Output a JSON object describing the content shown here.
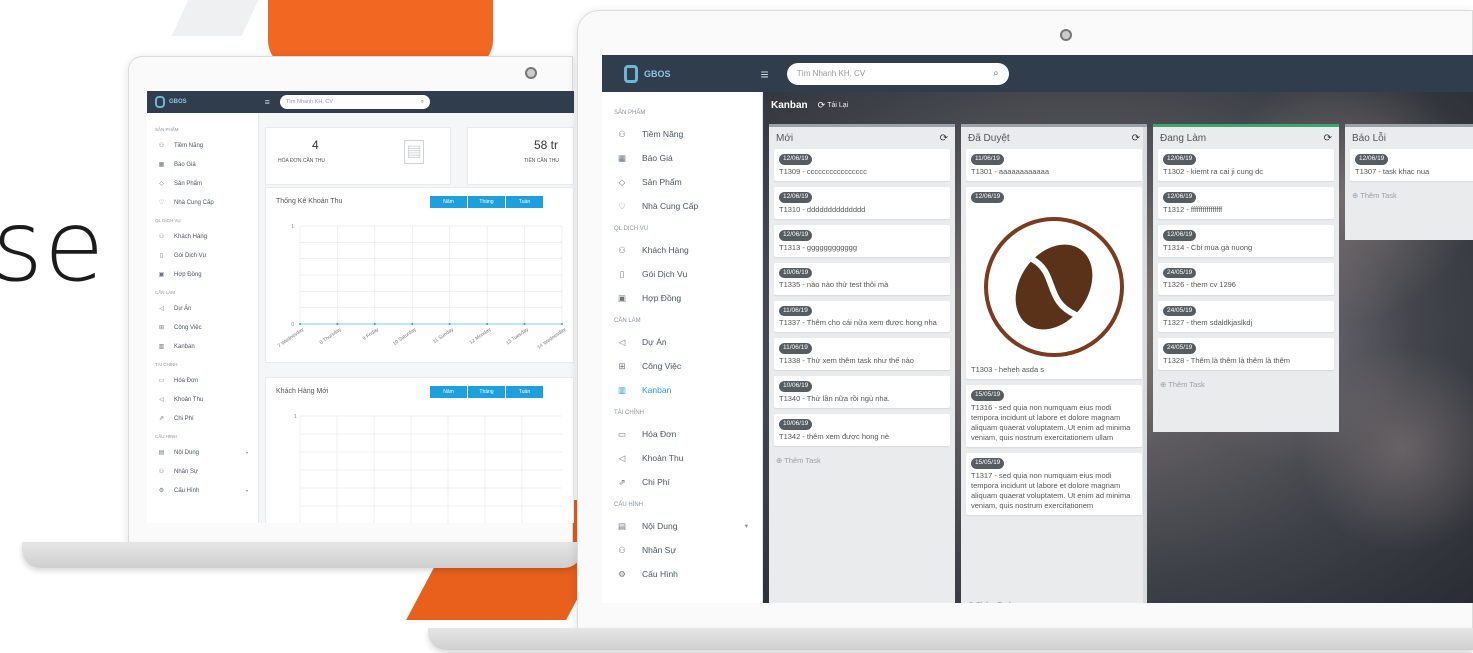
{
  "hero_text": "se",
  "small_laptop": {
    "logo": "GBOS",
    "search_placeholder": "Tìm Nhanh KH, CV",
    "sidebar": [
      {
        "type": "section",
        "label": "SẢN PHẨM"
      },
      {
        "type": "item",
        "icon": "users-icon",
        "glyph": "⚇",
        "label": "Tiềm Năng"
      },
      {
        "type": "item",
        "icon": "quote-icon",
        "glyph": "▦",
        "label": "Báo Giá"
      },
      {
        "type": "item",
        "icon": "tag-icon",
        "glyph": "◇",
        "label": "Sản Phẩm"
      },
      {
        "type": "item",
        "icon": "pin-icon",
        "glyph": "♡",
        "label": "Nhà Cung Cấp"
      },
      {
        "type": "section",
        "label": "QL DỊCH VỤ"
      },
      {
        "type": "item",
        "icon": "users-icon",
        "glyph": "⚇",
        "label": "Khách Hàng"
      },
      {
        "type": "item",
        "icon": "service-icon",
        "glyph": "▯",
        "label": "Gói Dịch Vụ"
      },
      {
        "type": "item",
        "icon": "contract-icon",
        "glyph": "▣",
        "label": "Hợp Đồng"
      },
      {
        "type": "section",
        "label": "CẦN LÀM"
      },
      {
        "type": "item",
        "icon": "send-icon",
        "glyph": "◁",
        "label": "Dự Án"
      },
      {
        "type": "item",
        "icon": "grid-icon",
        "glyph": "⊞",
        "label": "Công Việc"
      },
      {
        "type": "item",
        "icon": "kanban-icon",
        "glyph": "▥",
        "label": "Kanban"
      },
      {
        "type": "section",
        "label": "TÀI CHÍNH"
      },
      {
        "type": "item",
        "icon": "invoice-icon",
        "glyph": "▭",
        "label": "Hóa Đơn"
      },
      {
        "type": "item",
        "icon": "income-icon",
        "glyph": "◁",
        "label": "Khoản Thu"
      },
      {
        "type": "item",
        "icon": "expense-icon",
        "glyph": "⇗",
        "label": "Chi Phí"
      },
      {
        "type": "section",
        "label": "CẤU HÌNH"
      },
      {
        "type": "item",
        "icon": "content-icon",
        "glyph": "▤",
        "label": "Nội Dung",
        "arrow": true
      },
      {
        "type": "item",
        "icon": "staff-icon",
        "glyph": "⚇",
        "label": "Nhân Sự"
      },
      {
        "type": "item",
        "icon": "settings-icon",
        "glyph": "⚙",
        "label": "Cấu Hình",
        "arrow": true
      }
    ],
    "stat1_value": "4",
    "stat1_label": "HÓA ĐƠN CẦN THU",
    "stat2_value": "58 tr",
    "stat2_label": "TIỀN CẦN THU",
    "chart1_title": "Thống Kê Khoản Thu",
    "chart2_title": "Khách Hàng Mới",
    "range_buttons": [
      "Năm",
      "Tháng",
      "Tuần"
    ],
    "chart_data": {
      "type": "line",
      "categories": [
        "7 Wednesday",
        "8 Thursday",
        "9 Friday",
        "10 Saturday",
        "11 Sunday",
        "12 Monday",
        "13 Tuesday",
        "14 Wednesday"
      ],
      "values": [
        0,
        0,
        0,
        0,
        0,
        0,
        0,
        0
      ],
      "ylim": [
        0,
        1
      ],
      "yticks": [
        "1",
        "0"
      ],
      "grid": true
    },
    "chart2_ytick": "1"
  },
  "big_laptop": {
    "logo": "GBOS",
    "search_placeholder": "Tìm Nhanh KH, CV",
    "sidebar": [
      {
        "type": "section",
        "label": "SẢN PHẨM"
      },
      {
        "type": "item",
        "icon": "users-icon",
        "glyph": "⚇",
        "label": "Tiềm Năng"
      },
      {
        "type": "item",
        "icon": "quote-icon",
        "glyph": "▦",
        "label": "Báo Giá"
      },
      {
        "type": "item",
        "icon": "tag-icon",
        "glyph": "◇",
        "label": "Sản Phẩm"
      },
      {
        "type": "item",
        "icon": "pin-icon",
        "glyph": "♡",
        "label": "Nhà Cung Cấp"
      },
      {
        "type": "section",
        "label": "QL DỊCH VỤ"
      },
      {
        "type": "item",
        "icon": "users-icon",
        "glyph": "⚇",
        "label": "Khách Hàng"
      },
      {
        "type": "item",
        "icon": "service-icon",
        "glyph": "▯",
        "label": "Gói Dịch Vụ"
      },
      {
        "type": "item",
        "icon": "contract-icon",
        "glyph": "▣",
        "label": "Hợp Đồng"
      },
      {
        "type": "section",
        "label": "CẦN LÀM"
      },
      {
        "type": "item",
        "icon": "send-icon",
        "glyph": "◁",
        "label": "Dự Án"
      },
      {
        "type": "item",
        "icon": "grid-icon",
        "glyph": "⊞",
        "label": "Công Việc"
      },
      {
        "type": "item",
        "icon": "kanban-icon",
        "glyph": "▥",
        "label": "Kanban",
        "active": true
      },
      {
        "type": "section",
        "label": "TÀI CHÍNH"
      },
      {
        "type": "item",
        "icon": "invoice-icon",
        "glyph": "▭",
        "label": "Hóa Đơn"
      },
      {
        "type": "item",
        "icon": "income-icon",
        "glyph": "◁",
        "label": "Khoản Thu"
      },
      {
        "type": "item",
        "icon": "expense-icon",
        "glyph": "⇗",
        "label": "Chi Phí"
      },
      {
        "type": "section",
        "label": "CẤU HÌNH"
      },
      {
        "type": "item",
        "icon": "content-icon",
        "glyph": "▤",
        "label": "Nội Dung",
        "arrow": true
      },
      {
        "type": "item",
        "icon": "staff-icon",
        "glyph": "⚇",
        "label": "Nhân Sự"
      },
      {
        "type": "item",
        "icon": "settings-icon",
        "glyph": "⚙",
        "label": "Cấu Hình"
      }
    ],
    "kanban_title": "Kanban",
    "reload_label": "Tải Lại",
    "add_task_label": "Thêm Task",
    "columns": [
      {
        "title": "Mới",
        "cards": [
          {
            "date": "12/06/19",
            "text": "T1309 - cccccccccccccccc"
          },
          {
            "date": "12/06/19",
            "text": "T1310 - dddddddddddddd"
          },
          {
            "date": "12/06/19",
            "text": "T1313 - gggggggggggg"
          },
          {
            "date": "10/06/19",
            "text": "T1335 - nào nào thử test thôi mà"
          },
          {
            "date": "11/06/19",
            "text": "T1337 - Thêm cho cái nữa xem được hong nha"
          },
          {
            "date": "11/06/19",
            "text": "T1338 - Thử xem thêm task như thế nào"
          },
          {
            "date": "10/06/19",
            "text": "T1340 - Thử lần nữa rồi ngủ nha."
          },
          {
            "date": "10/06/19",
            "text": "T1342 - thêm xem được hong nè"
          }
        ]
      },
      {
        "title": "Đã Duyệt",
        "cards": [
          {
            "date": "11/06/19",
            "text": "T1301 - aaaaaaaaaaaa"
          },
          {
            "date": "12/06/19",
            "text": "T1303 - heheh asda s",
            "image": "coffee-bean-icon"
          },
          {
            "date": "15/05/19",
            "text": "T1316 - sed quia non numquam eius modi tempora incidunt ut labore et dolore magnam aliquam quaerat voluptatem. Ut enim ad minima veniam, quis nostrum exercitationem ullam"
          },
          {
            "date": "15/05/19",
            "text": "T1317 - sed quia non numquam eius modi tempora incidunt ut labore et dolore magnam aliquam quaerat voluptatem. Ut enim ad minima veniam, quis nostrum exercitationem"
          }
        ]
      },
      {
        "title": "Đang Làm",
        "cards": [
          {
            "date": "12/06/19",
            "text": "T1302 - kiemt ra cai ji cung dc"
          },
          {
            "date": "12/06/19",
            "text": "T1312 - ffffffffffffffff"
          },
          {
            "date": "12/06/19",
            "text": "T1314 - Cbi mua gà nuong"
          },
          {
            "date": "24/05/19",
            "text": "T1326 - them cv 1296"
          },
          {
            "date": "24/05/19",
            "text": "T1327 - them sdaldkjaslkdj"
          },
          {
            "date": "24/05/19",
            "text": "T1328 - Thêm là thêm là thêm là thêm"
          }
        ]
      },
      {
        "title": "Báo Lỗi",
        "cards": [
          {
            "date": "12/06/19",
            "text": "T1307 - task khac nua"
          }
        ]
      }
    ]
  }
}
